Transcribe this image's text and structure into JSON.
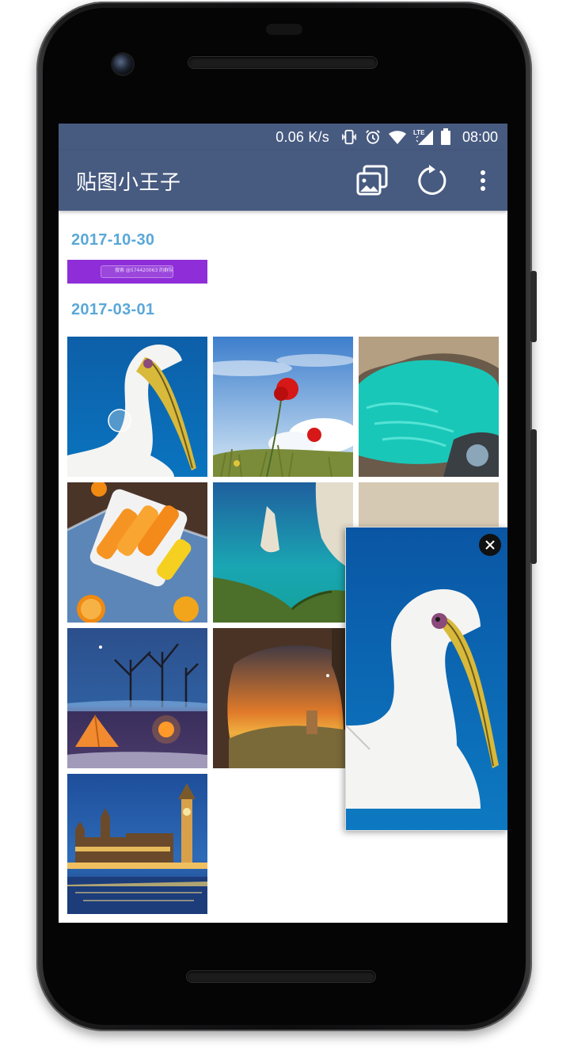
{
  "status_bar": {
    "network_speed": "0.06 K/s",
    "time": "08:00",
    "icons": [
      "vibrate-icon",
      "alarm-icon",
      "wifi-icon",
      "lte-signal-icon",
      "battery-icon"
    ]
  },
  "app_bar": {
    "title": "贴图小王子",
    "background": "#475a80",
    "actions": [
      "gallery-icon",
      "refresh-icon",
      "more-vert-icon"
    ]
  },
  "sections": [
    {
      "date": "2017-10-30",
      "items": [
        {
          "kind": "screenshot",
          "name": "qq-screenshot-banner",
          "caption": "搜索 @574420063 的群队"
        }
      ]
    },
    {
      "date": "2017-03-01",
      "items": [
        {
          "kind": "photo",
          "name": "pelican"
        },
        {
          "kind": "photo",
          "name": "red-poppies"
        },
        {
          "kind": "photo",
          "name": "sea-cave"
        },
        {
          "kind": "photo",
          "name": "popsicles"
        },
        {
          "kind": "photo",
          "name": "coastal-cliffs"
        },
        {
          "kind": "photo",
          "name": "hidden-tile-6"
        },
        {
          "kind": "photo",
          "name": "winter-camp"
        },
        {
          "kind": "photo",
          "name": "cave-sunset"
        },
        {
          "kind": "photo",
          "name": "beach-sand"
        },
        {
          "kind": "photo",
          "name": "big-ben-night"
        }
      ]
    }
  ],
  "floating_sticker": {
    "image": "pelican",
    "close_icon": "close-icon"
  },
  "colors": {
    "date_header": "#5aa8d8",
    "accent_purple": "#8f2ed8"
  }
}
